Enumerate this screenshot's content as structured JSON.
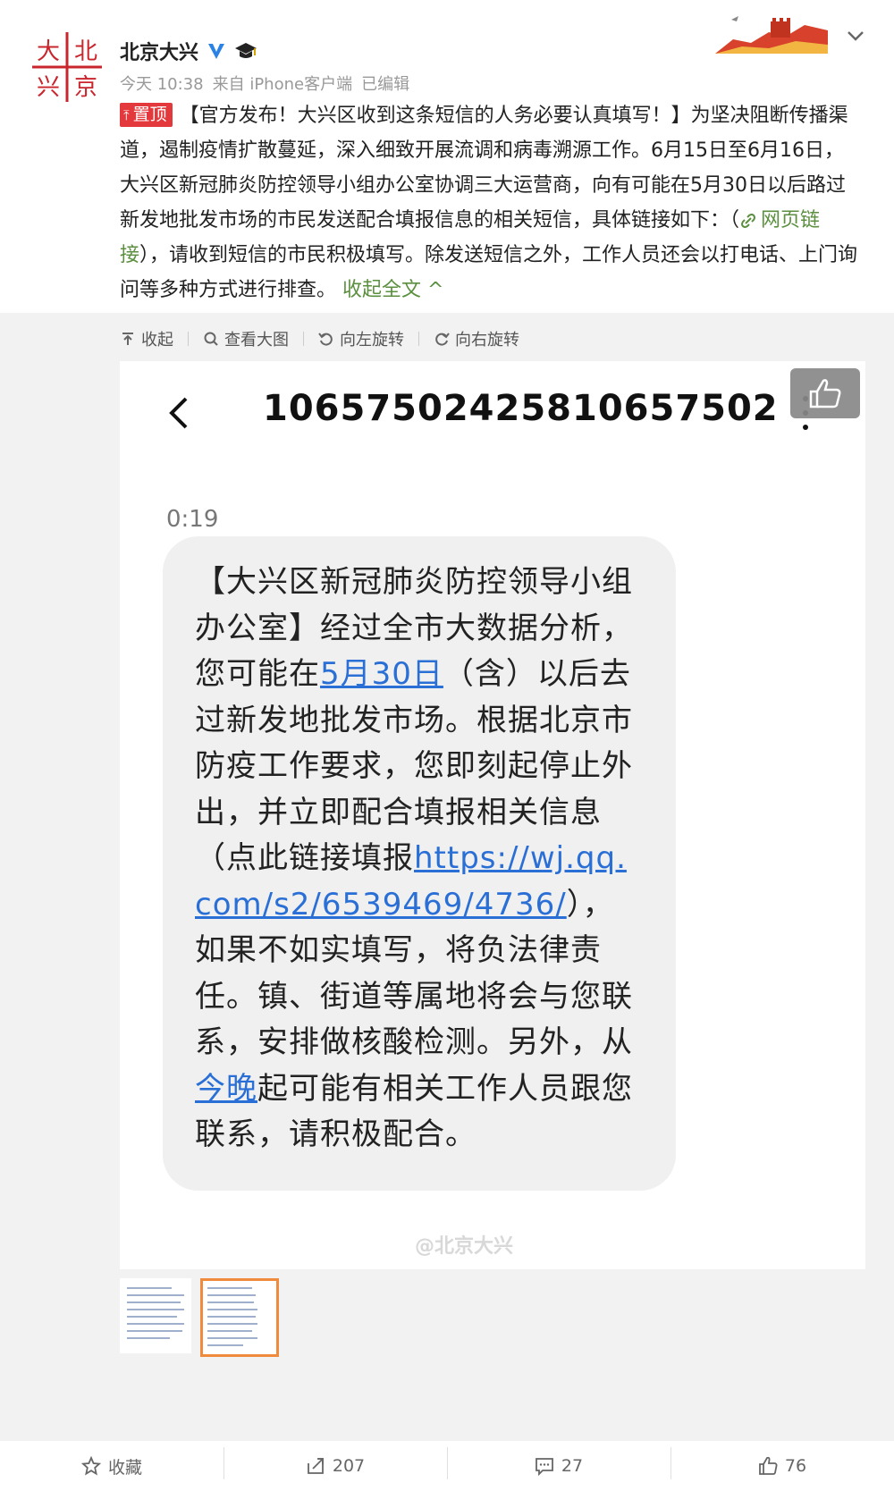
{
  "post": {
    "author": "北京大兴",
    "time": "今天 10:38",
    "source": "来自 iPhone客户端",
    "edited": "已编辑",
    "pin_label": "置顶",
    "text_before_link": "【官方发布！大兴区收到这条短信的人务必要认真填写！】为坚决阻断传播渠道，遏制疫情扩散蔓延，深入细致开展流调和病毒溯源工作。6月15日至6月16日，大兴区新冠肺炎防控领导小组办公室协调三大运营商，向有可能在5月30日以后路过新发地批发市场的市民发送配合填报信息的相关短信，具体链接如下：（",
    "link_label": "网页链接",
    "text_after_link": "），请收到短信的市民积极填写。除发送短信之外，工作人员还会以打电话、上门询问等多种方式进行排查。",
    "collapse_label": "收起全文 ^"
  },
  "toolbar": {
    "collapse": "收起",
    "view_large": "查看大图",
    "rotate_left": "向左旋转",
    "rotate_right": "向右旋转"
  },
  "sms": {
    "number": "10657502425810657502",
    "time": "0:19",
    "t1": "【大兴区新冠肺炎防控领导小组办公室】经过全市大数据分析，您可能在",
    "date_link": "5月30日",
    "t2": "（含）以后去过新发地批发市场。根据北京市防疫工作要求，您即刻起停止外出，并立即配合填报相关信息（点此链接填报",
    "url": "https://wj.qq.com/s2/6539469/4736/",
    "t3": "），如果不如实填写，将负法律责任。镇、街道等属地将会与您联系，安排做核酸检测。另外，从",
    "tonight_link": "今晚",
    "t4": "起可能有相关工作人员跟您联系，请积极配合。",
    "watermark": "@北京大兴"
  },
  "actions": {
    "favorite": "收藏",
    "repost": "207",
    "comments": "27",
    "likes": "76"
  },
  "colors": {
    "pin_red": "#e4393c",
    "link_green": "#5b8f3f",
    "sms_link_blue": "#2a6fd6",
    "thumb_active": "#f08a3c"
  }
}
